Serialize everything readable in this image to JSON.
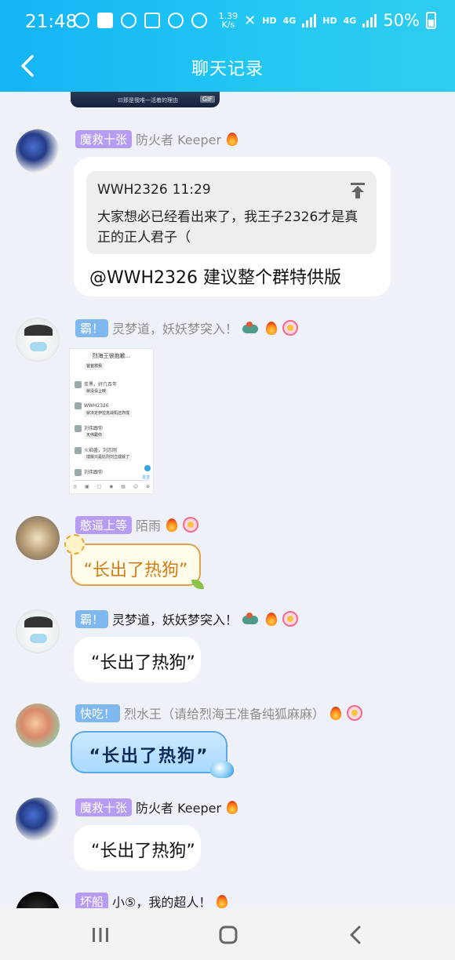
{
  "status_bar": {
    "time": "21:48",
    "net_speed_value": "1.39",
    "net_speed_unit": "K/s",
    "hd1": "HD",
    "net1": "4G",
    "hd2": "HD",
    "net2": "4G",
    "battery": "50%"
  },
  "header": {
    "title": "聊天记录"
  },
  "top_gif": {
    "caption": "曰那是我唯一活着的理由",
    "badge": "GIF"
  },
  "messages": [
    {
      "tag": "魔救十张",
      "name": "防火者 Keeper",
      "quote_author": "WWH2326",
      "quote_time": "11:29",
      "quote_text": "大家想必已经看出来了，我王子2326才是真正的正人君子（",
      "text": "@WWH2326 建议整个群特供版"
    },
    {
      "tag": "霸！",
      "name": "灵梦道，妖妖梦突入！",
      "screenshot": {
        "title": "烈海王很抱歉...",
        "rows": [
          "爸爸救我",
          "炭黑，好几百年",
          "就没设上映",
          "WWH2326",
          "就决定伊拉克战机还炸成",
          "刘伟跟你",
          "天伟跟你",
          "火焰盛，刘志刚",
          "成就只是比烈刘立成就了",
          "刘伟跟你"
        ],
        "send_label": "发送"
      }
    },
    {
      "tag": "憨逼上等",
      "name": "陌雨",
      "text": "“长出了热狗”"
    },
    {
      "tag": "霸！",
      "name": "灵梦道，妖妖梦突入！",
      "text": "“长出了热狗”"
    },
    {
      "tag": "快吃！",
      "name": "烈水王（请给烈海王准备纯狐麻麻）",
      "text": "“长出了热狗”"
    },
    {
      "tag": "魔救十张",
      "name": "防火者 Keeper",
      "text": "“长出了热狗”"
    },
    {
      "tag": "坏船",
      "name": "小⑤，我的超人！"
    }
  ],
  "icons": {
    "back": "chevron-left-icon",
    "nav_recent": "recent-apps-icon",
    "nav_home": "home-icon",
    "nav_back": "back-icon"
  },
  "colors": {
    "header_start": "#14b4f5",
    "header_end": "#2fcdf0",
    "tag_purple": "#b79cf3",
    "tag_blue": "#7fb8ef",
    "background": "#eef1f7"
  }
}
